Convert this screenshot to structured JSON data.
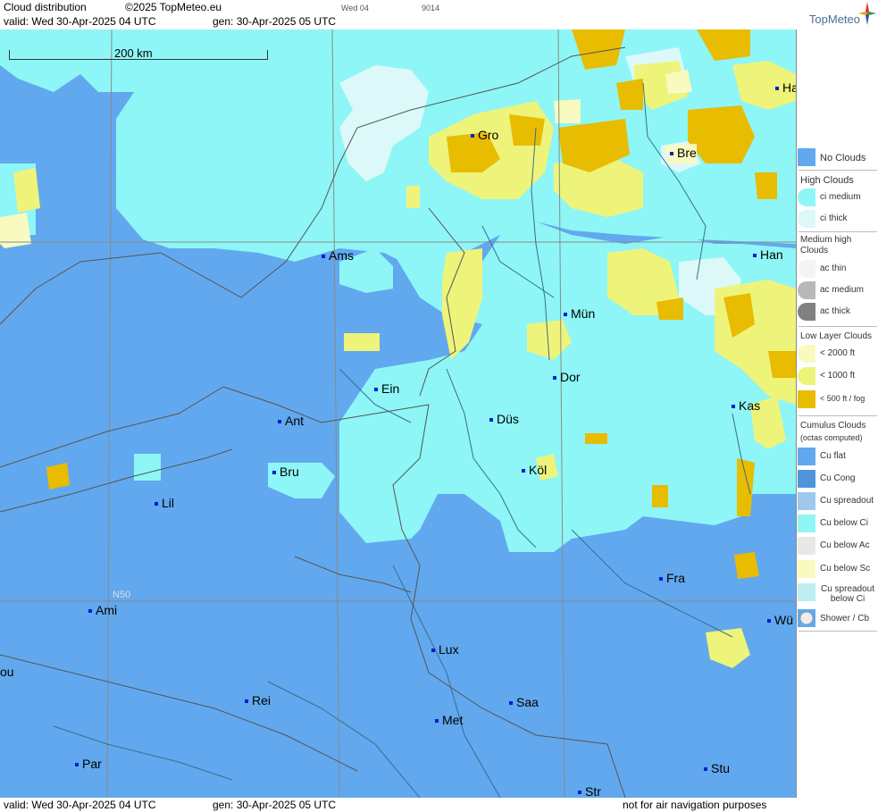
{
  "header": {
    "product": "Cloud distribution",
    "copyright": "©2025 TopMeteo.eu",
    "valid": "valid:  Wed  30-Apr-2025  04 UTC",
    "gen": "gen: 30-Apr-2025 05 UTC",
    "small_a": "Wed 04",
    "small_b": "9014",
    "brand": "TopMeteo"
  },
  "map": {
    "scale_label": "200 km",
    "lat_label": "N50",
    "cities": [
      {
        "id": "gro",
        "label": "Gro"
      },
      {
        "id": "bre",
        "label": "Bre"
      },
      {
        "id": "ha",
        "label": "Ha"
      },
      {
        "id": "ams",
        "label": "Ams"
      },
      {
        "id": "han",
        "label": "Han"
      },
      {
        "id": "mun",
        "label": "Mün"
      },
      {
        "id": "dor",
        "label": "Dor"
      },
      {
        "id": "ein",
        "label": "Ein"
      },
      {
        "id": "ant",
        "label": "Ant"
      },
      {
        "id": "dus",
        "label": "Düs"
      },
      {
        "id": "kas",
        "label": "Kas"
      },
      {
        "id": "bru",
        "label": "Bru"
      },
      {
        "id": "kol",
        "label": "Köl"
      },
      {
        "id": "lil",
        "label": "Lil"
      },
      {
        "id": "fra",
        "label": "Fra"
      },
      {
        "id": "ami",
        "label": "Ami"
      },
      {
        "id": "wu",
        "label": "Wü"
      },
      {
        "id": "lux",
        "label": "Lux"
      },
      {
        "id": "ou",
        "label": "ou"
      },
      {
        "id": "rei",
        "label": "Rei"
      },
      {
        "id": "saa",
        "label": "Saa"
      },
      {
        "id": "met",
        "label": "Met"
      },
      {
        "id": "par",
        "label": "Par"
      },
      {
        "id": "stu",
        "label": "Stu"
      },
      {
        "id": "str",
        "label": "Str"
      }
    ]
  },
  "legend": {
    "no_clouds": "No Clouds",
    "high_head": "High Clouds",
    "ci_medium": "ci medium",
    "ci_thick": "ci thick",
    "mid_head": "Medium high Clouds",
    "ac_thin": "ac thin",
    "ac_medium": "ac medium",
    "ac_thick": "ac thick",
    "low_head": "Low Layer Clouds",
    "low_2000": "< 2000 ft",
    "low_1000": "< 1000 ft",
    "low_500": "< 500 ft / fog",
    "cu_head": "Cumulus Clouds",
    "cu_sub": "(octas computed)",
    "cu_flat": "Cu flat",
    "cu_cong": "Cu Cong",
    "cu_spread": "Cu spreadout",
    "cu_below_ci": "Cu below Ci",
    "cu_below_ac": "Cu below Ac",
    "cu_below_sc": "Cu below Sc",
    "cu_spread_ci": "Cu spreadout below Ci",
    "shower": "Shower / Cb"
  },
  "footer": {
    "valid": "valid:  Wed  30-Apr-2025  04 UTC",
    "gen": "gen: 30-Apr-2025 05 UTC",
    "note": "not for air navigation purposes"
  },
  "colors": {
    "no_clouds": "#62a8ee",
    "ci_medium": "#8ef6f6",
    "ci_thick": "#ddf8f8",
    "low_2000": "#f8fac0",
    "low_1000": "#eef47a",
    "low_500": "#e8bc00"
  }
}
